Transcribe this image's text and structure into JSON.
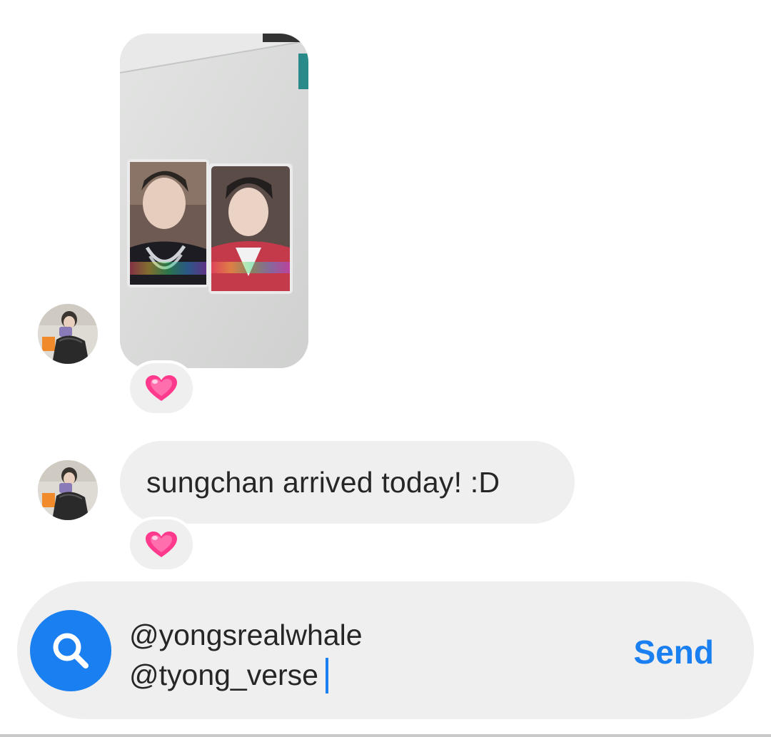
{
  "conversation": {
    "messages": [
      {
        "type": "photo",
        "sender": "other",
        "reaction": "growing-heart"
      },
      {
        "type": "text",
        "sender": "other",
        "text": "sungchan arrived today! :D",
        "reaction": "growing-heart"
      }
    ]
  },
  "composer": {
    "lines": [
      "@yongsrealwhale",
      "@tyong_verse"
    ],
    "send_label": "Send",
    "search_icon": "search-icon"
  },
  "colors": {
    "accent": "#1a7ff0",
    "bubble": "#efefef",
    "text": "#262626",
    "heart": "#ff3a8c"
  }
}
